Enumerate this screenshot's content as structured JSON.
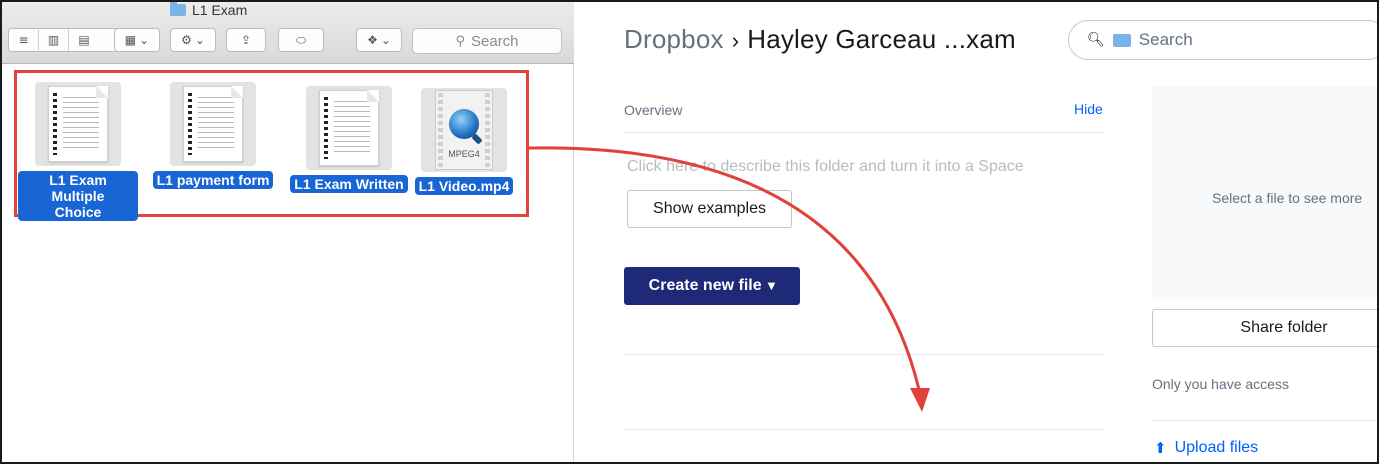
{
  "finder": {
    "window_title": "L1 Exam",
    "toolbar": {
      "view_list_icon": "list-view-icon",
      "view_columns_icon": "column-view-icon",
      "view_coverflow_icon": "coverflow-view-icon",
      "arrange_icon": "arrange-icon",
      "action_icon": "gear-icon",
      "share_icon": "share-icon",
      "tag_icon": "tag-icon",
      "dropbox_icon": "dropbox-icon",
      "search_placeholder": "Search"
    },
    "files": [
      {
        "name_line1": "L1 Exam Multiple",
        "name_line2": "Choice",
        "kind": "document"
      },
      {
        "name_line1": "L1 payment form",
        "kind": "document"
      },
      {
        "name_line1": "L1 Exam Written",
        "kind": "document"
      },
      {
        "name_line1": "L1 Video.mp4",
        "kind": "video",
        "badge": "MPEG4"
      }
    ]
  },
  "dropbox": {
    "breadcrumb": {
      "root": "Dropbox",
      "separator": "›",
      "current": "Hayley Garceau ...xam"
    },
    "search_placeholder": "Search",
    "overview": {
      "label": "Overview",
      "hide": "Hide"
    },
    "describe_prompt": "Click here to describe this folder and turn it into a Space",
    "show_examples": "Show examples",
    "create_new_file": "Create new file",
    "preview_text": "Select a file to see more",
    "share_folder": "Share folder",
    "access_text": "Only you have access",
    "upload_files": "Upload files"
  },
  "colors": {
    "selection_highlight": "#1865d6",
    "annotation_red": "#e0413a",
    "dropbox_navy": "#1e2a78",
    "link_blue": "#0061fe"
  }
}
